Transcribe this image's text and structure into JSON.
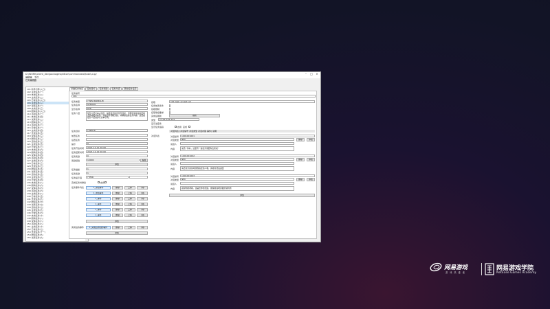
{
  "window": {
    "title": "D:\\WORK\\client_dev\\packages\\editor\\commonweal\\task\\ui.py",
    "menu": [
      "编辑器",
      "文件"
    ],
    "subtitle": "任务编辑器"
  },
  "tree": {
    "selected_index": 5,
    "items": [
      "101 新手引导(入口)",
      "102 主线任务(一)",
      "103 支线任务(二)",
      "104 主线任务(二)",
      "105 日常任务(入口)",
      "106 主线任务(三)",
      "107 试炼任务(一)",
      "108 支线任务(三)",
      "109 剧情任务(入口)",
      "110 活动任务(一)",
      "111 支线任务(四)",
      "112 试炼任务(二)",
      "113 剧情任务(二)",
      "114 活动任务(二)",
      "115 日常任务(一)",
      "116 主线任务(四)",
      "117 支线任务(五)",
      "118 试炼任务(三)",
      "119 剧情任务(三)",
      "120 活动任务(三)",
      "121 主线任务(五)",
      "122 日常任务(二)",
      "123 支线任务(六)",
      "124 剧情任务(四)",
      "125 试炼任务(四)",
      "126 活动任务(四)",
      "127 主线任务(六)",
      "128 日常任务(三)",
      "129 支线任务(七)",
      "130 剧情任务(五)",
      "131 试炼任务(五)",
      "132 活动任务(五)",
      "133 主线任务(七)",
      "134 日常任务(四)",
      "135 支线任务(八)",
      "136 剧情任务(六)",
      "137 试炼任务(六)",
      "138 活动任务(六)",
      "139 主线任务(八)",
      "140 日常任务(五)",
      "141 支线任务(九)",
      "142 剧情任务(七)",
      "143 试炼任务(七)",
      "144 活动任务(七)",
      "145 主线任务(九)",
      "146 日常任务(六)",
      "147 支线任务(十)",
      "148 剧情任务(八)",
      "149 试炼任务(八)",
      "150 活动任务(八)",
      "151 主线任务(十)",
      "152 日常任务(七)",
      "153 支线任务(十一)",
      "154 剧情任务(九)",
      "155 试炼任务(九)"
    ]
  },
  "tabs": [
    "基础任务信息",
    "任务目标",
    "任务奖励",
    "任务对话",
    "其他任务设定"
  ],
  "form": {
    "task_id_label": "任务编号",
    "task_id_value": "101",
    "left_labels": [
      "任务类型",
      "任务名称",
      "显示名称",
      "任务介绍"
    ],
    "task_type": "日常任务模板任务",
    "task_name": "任务名称",
    "display_name": "任务",
    "intro": "任务介绍文本占位符，描述任务的背景与目标，引导玩家前往指定地点完成相关操作。完成后可领取奖励，并解锁后续任务内容。这里是任务介绍的多行文本示例。",
    "right_labels": [
      "接取",
      "任务前置条件",
      "接取限制",
      "接取等级要求",
      "完成后刷新"
    ],
    "accept_value": "101 task_accept_all",
    "refresh_btn": "刷新",
    "type_field_label": "类型",
    "type_field_value": "1:101-101-101",
    "extra_labels": [
      "显示进度条",
      "显示任务追踪"
    ],
    "check_a": "启用",
    "check_b": "完成",
    "mid_labels": [
      "任务目标",
      "前置任务",
      "后置任务",
      "提示",
      "任务开启时间",
      "任务结束时间",
      "任务奖励",
      "奖励经验"
    ],
    "mid_values": [
      "日常任务",
      "",
      "",
      "0",
      "0",
      "2021-11-11 00:00",
      "2021-12-12 00:00",
      "0",
      "10000"
    ],
    "edit_btn": "编辑",
    "add_btn": "添加",
    "lower_labels": [
      "任务描述",
      "任务奖励",
      "任务提示语",
      "完成任务时弹窗",
      "任务事件列表"
    ],
    "reward_value": "1",
    "hint_value": "1",
    "status_value": "已启用",
    "checkbox_label": "启用",
    "events": [
      "1_添加事件",
      "1_添加事件",
      "1_事件",
      "1_事件",
      "1_事件",
      "1_事件"
    ],
    "event_actions": [
      "删除",
      "上移",
      "下移"
    ],
    "add_event_btn": "添加",
    "complete_events_label": "完成后的事件",
    "complete_event": "1_完成后添加的事件",
    "complete_add_btn": "添加"
  },
  "dialog": {
    "header": "对话列表    [对话编号  对话类型  对话内容  事件] 说明",
    "section_label": "对话列表",
    "entries": [
      {
        "id_label": "对话编号",
        "id": "1001001001",
        "type_label": "对话类型",
        "type": "NPC",
        "speaker_label": "说话人",
        "speaker": "",
        "content_label": "内容",
        "content": "说话:“你好，这里有一些任务需要你去完成”",
        "del": "删除",
        "add": "添加"
      },
      {
        "id_label": "对话编号",
        "id": "1001001002",
        "type_label": "对话类型",
        "type": "NPC",
        "speaker_label": "说话人",
        "speaker": "",
        "content_label": "内容",
        "content": "请去前方的营地找到指定的人物，完成对话后返回",
        "del": "删除",
        "add": "添加"
      },
      {
        "id_label": "对话编号",
        "id": "1001001003",
        "type_label": "对话类型",
        "type": "NPC",
        "speaker_label": "说话人",
        "speaker": "",
        "content_label": "内容",
        "content": "感谢你的帮助，这是给你的奖励，继续前进吧勇敢的冒险者",
        "del": "删除",
        "add": "添加"
      }
    ],
    "add_btn": "添加"
  },
  "branding": {
    "logo1": "网易游戏",
    "logo1_sub": "游 戏 热 爱 者",
    "logo2": "网易游戏学院",
    "logo2_en": "NetEase Games Academy"
  },
  "colors": {
    "background": "#121426",
    "accent_glow": "#3a1530",
    "window": "#f0f0f0",
    "selection": "#cce4f7"
  }
}
